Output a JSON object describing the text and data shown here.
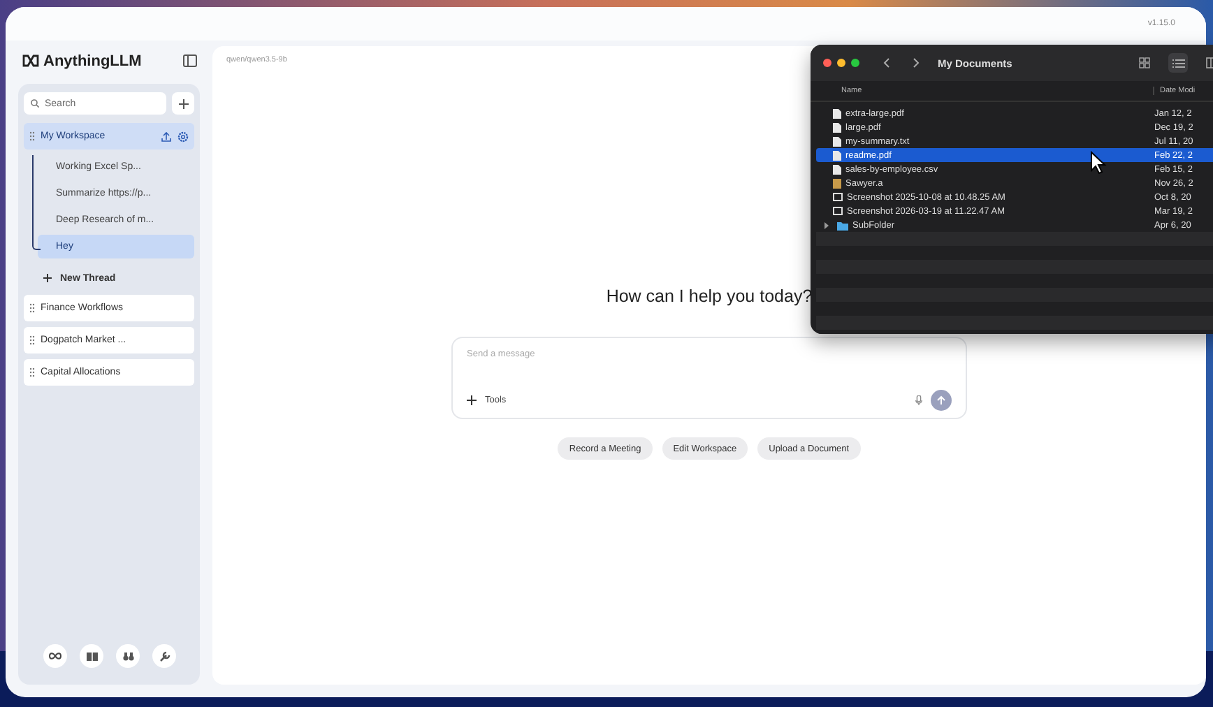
{
  "app": {
    "version": "v1.15.0",
    "logo": "AnythingLLM"
  },
  "sidebar": {
    "search": {
      "placeholder": "Search"
    },
    "workspaces": [
      {
        "name": "My Workspace",
        "selected": true,
        "children": [
          {
            "name": "Working Excel Sp...",
            "selected": false
          },
          {
            "name": "Summarize https://p...",
            "selected": false
          },
          {
            "name": "Deep Research of m...",
            "selected": false
          },
          {
            "name": "Hey",
            "selected": true
          }
        ]
      },
      {
        "name": "Finance Workflows",
        "selected": false
      },
      {
        "name": "Dogpatch Market ...",
        "selected": false
      },
      {
        "name": "Capital Allocations",
        "selected": false
      }
    ],
    "new_thread": "New Thread"
  },
  "main": {
    "model": "qwen/qwen3.5-9b",
    "heading": "How can I help you today?",
    "composer": {
      "placeholder": "Send a message",
      "tools": "Tools"
    },
    "suggestions": [
      "Record a Meeting",
      "Edit Workspace",
      "Upload a Document"
    ]
  },
  "finder": {
    "title": "My Documents",
    "columns": [
      "Name",
      "Date Modi"
    ],
    "files": [
      {
        "name": "extra-large.pdf",
        "date": "Jan 12, 2",
        "kind": "doc",
        "selected": false
      },
      {
        "name": "large.pdf",
        "date": "Dec 19, 2",
        "kind": "doc",
        "selected": false
      },
      {
        "name": "my-summary.txt",
        "date": "Jul 11, 20",
        "kind": "doc",
        "selected": false
      },
      {
        "name": "readme.pdf",
        "date": "Feb 22, 2",
        "kind": "doc",
        "selected": true
      },
      {
        "name": "sales-by-employee.csv",
        "date": "Feb 15, 2",
        "kind": "doc",
        "selected": false
      },
      {
        "name": "Sawyer.a",
        "date": "Nov 26, 2",
        "kind": "image",
        "selected": false
      },
      {
        "name": "Screenshot 2025-10-08 at 10.48.25 AM",
        "date": "Oct 8, 20",
        "kind": "screenshot",
        "selected": false
      },
      {
        "name": "Screenshot 2026-03-19 at 11.22.47 AM",
        "date": "Mar 19, 2",
        "kind": "screenshot",
        "selected": false
      },
      {
        "name": "SubFolder",
        "date": "Apr 6, 20",
        "kind": "folder",
        "selected": false
      }
    ]
  }
}
